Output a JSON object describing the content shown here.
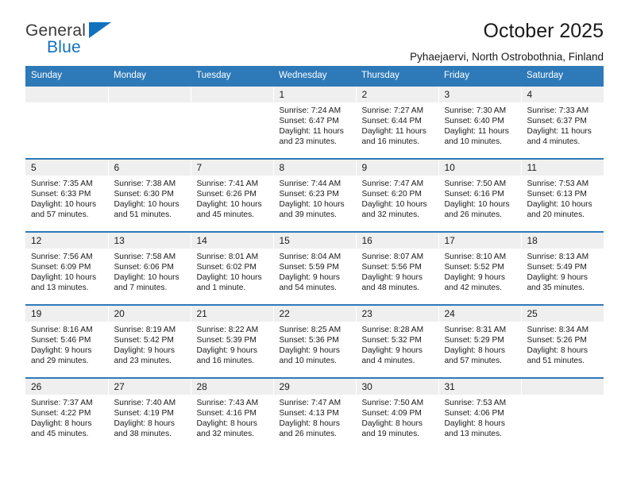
{
  "logo": {
    "word_one": "General",
    "word_two": "Blue",
    "mark": "triangle-icon",
    "accent_color": "#1271bd"
  },
  "header": {
    "title": "October 2025",
    "subtitle": "Pyhaejaervi, North Ostrobothnia, Finland"
  },
  "theme": {
    "header_band": "#2e7ab8",
    "daynum_band": "#efefef",
    "text": "#1a1a1a"
  },
  "calendar": {
    "weekday_headers": [
      "Sunday",
      "Monday",
      "Tuesday",
      "Wednesday",
      "Thursday",
      "Friday",
      "Saturday"
    ],
    "weeks": [
      [
        {
          "day": "",
          "sunrise": "",
          "sunset": "",
          "daylight_line1": "",
          "daylight_line2": ""
        },
        {
          "day": "",
          "sunrise": "",
          "sunset": "",
          "daylight_line1": "",
          "daylight_line2": ""
        },
        {
          "day": "",
          "sunrise": "",
          "sunset": "",
          "daylight_line1": "",
          "daylight_line2": ""
        },
        {
          "day": "1",
          "sunrise": "Sunrise: 7:24 AM",
          "sunset": "Sunset: 6:47 PM",
          "daylight_line1": "Daylight: 11 hours",
          "daylight_line2": "and 23 minutes."
        },
        {
          "day": "2",
          "sunrise": "Sunrise: 7:27 AM",
          "sunset": "Sunset: 6:44 PM",
          "daylight_line1": "Daylight: 11 hours",
          "daylight_line2": "and 16 minutes."
        },
        {
          "day": "3",
          "sunrise": "Sunrise: 7:30 AM",
          "sunset": "Sunset: 6:40 PM",
          "daylight_line1": "Daylight: 11 hours",
          "daylight_line2": "and 10 minutes."
        },
        {
          "day": "4",
          "sunrise": "Sunrise: 7:33 AM",
          "sunset": "Sunset: 6:37 PM",
          "daylight_line1": "Daylight: 11 hours",
          "daylight_line2": "and 4 minutes."
        }
      ],
      [
        {
          "day": "5",
          "sunrise": "Sunrise: 7:35 AM",
          "sunset": "Sunset: 6:33 PM",
          "daylight_line1": "Daylight: 10 hours",
          "daylight_line2": "and 57 minutes."
        },
        {
          "day": "6",
          "sunrise": "Sunrise: 7:38 AM",
          "sunset": "Sunset: 6:30 PM",
          "daylight_line1": "Daylight: 10 hours",
          "daylight_line2": "and 51 minutes."
        },
        {
          "day": "7",
          "sunrise": "Sunrise: 7:41 AM",
          "sunset": "Sunset: 6:26 PM",
          "daylight_line1": "Daylight: 10 hours",
          "daylight_line2": "and 45 minutes."
        },
        {
          "day": "8",
          "sunrise": "Sunrise: 7:44 AM",
          "sunset": "Sunset: 6:23 PM",
          "daylight_line1": "Daylight: 10 hours",
          "daylight_line2": "and 39 minutes."
        },
        {
          "day": "9",
          "sunrise": "Sunrise: 7:47 AM",
          "sunset": "Sunset: 6:20 PM",
          "daylight_line1": "Daylight: 10 hours",
          "daylight_line2": "and 32 minutes."
        },
        {
          "day": "10",
          "sunrise": "Sunrise: 7:50 AM",
          "sunset": "Sunset: 6:16 PM",
          "daylight_line1": "Daylight: 10 hours",
          "daylight_line2": "and 26 minutes."
        },
        {
          "day": "11",
          "sunrise": "Sunrise: 7:53 AM",
          "sunset": "Sunset: 6:13 PM",
          "daylight_line1": "Daylight: 10 hours",
          "daylight_line2": "and 20 minutes."
        }
      ],
      [
        {
          "day": "12",
          "sunrise": "Sunrise: 7:56 AM",
          "sunset": "Sunset: 6:09 PM",
          "daylight_line1": "Daylight: 10 hours",
          "daylight_line2": "and 13 minutes."
        },
        {
          "day": "13",
          "sunrise": "Sunrise: 7:58 AM",
          "sunset": "Sunset: 6:06 PM",
          "daylight_line1": "Daylight: 10 hours",
          "daylight_line2": "and 7 minutes."
        },
        {
          "day": "14",
          "sunrise": "Sunrise: 8:01 AM",
          "sunset": "Sunset: 6:02 PM",
          "daylight_line1": "Daylight: 10 hours",
          "daylight_line2": "and 1 minute."
        },
        {
          "day": "15",
          "sunrise": "Sunrise: 8:04 AM",
          "sunset": "Sunset: 5:59 PM",
          "daylight_line1": "Daylight: 9 hours",
          "daylight_line2": "and 54 minutes."
        },
        {
          "day": "16",
          "sunrise": "Sunrise: 8:07 AM",
          "sunset": "Sunset: 5:56 PM",
          "daylight_line1": "Daylight: 9 hours",
          "daylight_line2": "and 48 minutes."
        },
        {
          "day": "17",
          "sunrise": "Sunrise: 8:10 AM",
          "sunset": "Sunset: 5:52 PM",
          "daylight_line1": "Daylight: 9 hours",
          "daylight_line2": "and 42 minutes."
        },
        {
          "day": "18",
          "sunrise": "Sunrise: 8:13 AM",
          "sunset": "Sunset: 5:49 PM",
          "daylight_line1": "Daylight: 9 hours",
          "daylight_line2": "and 35 minutes."
        }
      ],
      [
        {
          "day": "19",
          "sunrise": "Sunrise: 8:16 AM",
          "sunset": "Sunset: 5:46 PM",
          "daylight_line1": "Daylight: 9 hours",
          "daylight_line2": "and 29 minutes."
        },
        {
          "day": "20",
          "sunrise": "Sunrise: 8:19 AM",
          "sunset": "Sunset: 5:42 PM",
          "daylight_line1": "Daylight: 9 hours",
          "daylight_line2": "and 23 minutes."
        },
        {
          "day": "21",
          "sunrise": "Sunrise: 8:22 AM",
          "sunset": "Sunset: 5:39 PM",
          "daylight_line1": "Daylight: 9 hours",
          "daylight_line2": "and 16 minutes."
        },
        {
          "day": "22",
          "sunrise": "Sunrise: 8:25 AM",
          "sunset": "Sunset: 5:36 PM",
          "daylight_line1": "Daylight: 9 hours",
          "daylight_line2": "and 10 minutes."
        },
        {
          "day": "23",
          "sunrise": "Sunrise: 8:28 AM",
          "sunset": "Sunset: 5:32 PM",
          "daylight_line1": "Daylight: 9 hours",
          "daylight_line2": "and 4 minutes."
        },
        {
          "day": "24",
          "sunrise": "Sunrise: 8:31 AM",
          "sunset": "Sunset: 5:29 PM",
          "daylight_line1": "Daylight: 8 hours",
          "daylight_line2": "and 57 minutes."
        },
        {
          "day": "25",
          "sunrise": "Sunrise: 8:34 AM",
          "sunset": "Sunset: 5:26 PM",
          "daylight_line1": "Daylight: 8 hours",
          "daylight_line2": "and 51 minutes."
        }
      ],
      [
        {
          "day": "26",
          "sunrise": "Sunrise: 7:37 AM",
          "sunset": "Sunset: 4:22 PM",
          "daylight_line1": "Daylight: 8 hours",
          "daylight_line2": "and 45 minutes."
        },
        {
          "day": "27",
          "sunrise": "Sunrise: 7:40 AM",
          "sunset": "Sunset: 4:19 PM",
          "daylight_line1": "Daylight: 8 hours",
          "daylight_line2": "and 38 minutes."
        },
        {
          "day": "28",
          "sunrise": "Sunrise: 7:43 AM",
          "sunset": "Sunset: 4:16 PM",
          "daylight_line1": "Daylight: 8 hours",
          "daylight_line2": "and 32 minutes."
        },
        {
          "day": "29",
          "sunrise": "Sunrise: 7:47 AM",
          "sunset": "Sunset: 4:13 PM",
          "daylight_line1": "Daylight: 8 hours",
          "daylight_line2": "and 26 minutes."
        },
        {
          "day": "30",
          "sunrise": "Sunrise: 7:50 AM",
          "sunset": "Sunset: 4:09 PM",
          "daylight_line1": "Daylight: 8 hours",
          "daylight_line2": "and 19 minutes."
        },
        {
          "day": "31",
          "sunrise": "Sunrise: 7:53 AM",
          "sunset": "Sunset: 4:06 PM",
          "daylight_line1": "Daylight: 8 hours",
          "daylight_line2": "and 13 minutes."
        },
        {
          "day": "",
          "sunrise": "",
          "sunset": "",
          "daylight_line1": "",
          "daylight_line2": ""
        }
      ]
    ]
  }
}
